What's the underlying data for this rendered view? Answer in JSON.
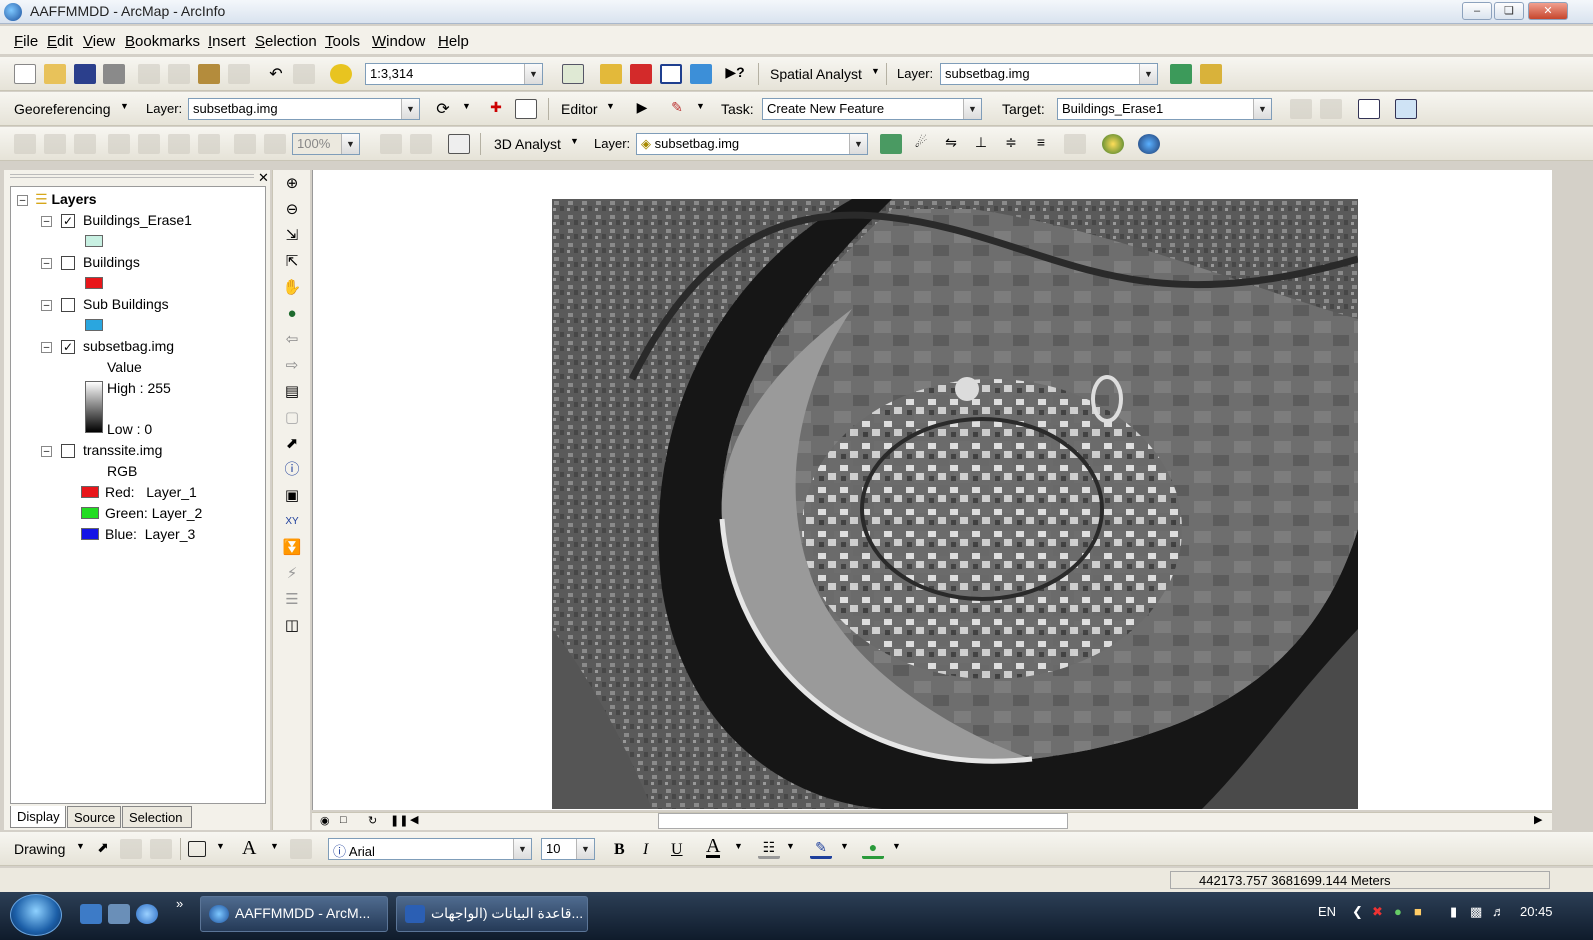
{
  "window": {
    "title": "AAFFMMDD - ArcMap - ArcInfo"
  },
  "menu": [
    "File",
    "Edit",
    "View",
    "Bookmarks",
    "Insert",
    "Selection",
    "Tools",
    "Window",
    "Help"
  ],
  "standard_toolbar": {
    "scale": "1:3,314",
    "spatial_analyst_label": "Spatial Analyst",
    "layer_label": "Layer:",
    "layer_value": "subsetbag.img"
  },
  "georef_toolbar": {
    "georeferencing_label": "Georeferencing",
    "layer_label": "Layer:",
    "layer_value": "subsetbag.img",
    "editor_label": "Editor",
    "task_label": "Task:",
    "task_value": "Create New Feature",
    "target_label": "Target:",
    "target_value": "Buildings_Erase1"
  },
  "third_toolbar": {
    "zoom_value": "100%",
    "analyst_label": "3D Analyst",
    "layer_label": "Layer:",
    "layer_value": "subsetbag.img"
  },
  "toc": {
    "root": "Layers",
    "layers": [
      {
        "name": "Buildings_Erase1",
        "checked": "✓",
        "swatch": "#c8f0e2"
      },
      {
        "name": "Buildings",
        "checked": "",
        "swatch": "#e8161a"
      },
      {
        "name": "Sub Buildings",
        "checked": "",
        "swatch": "#2aa6df"
      },
      {
        "name": "subsetbag.img",
        "checked": "✓",
        "value_label": "Value",
        "high": "High : 255",
        "low": "Low : 0"
      },
      {
        "name": "transsite.img",
        "checked": "",
        "rgb_label": "RGB",
        "bands": [
          {
            "label": "Red:",
            "layer": "Layer_1",
            "color": "#e8161a"
          },
          {
            "label": "Green:",
            "layer": "Layer_2",
            "color": "#22dd22"
          },
          {
            "label": "Blue:",
            "layer": "Layer_3",
            "color": "#1414e6"
          }
        ]
      }
    ],
    "tabs": [
      "Display",
      "Source",
      "Selection"
    ]
  },
  "drawing_toolbar": {
    "drawing_label": "Drawing",
    "font": "Arial",
    "font_size": "10",
    "bold": "B",
    "italic": "I",
    "underline": "U",
    "font_color_glyph": "A",
    "text_tool_glyph": "A"
  },
  "status": {
    "coordinates": "442173.757  3681699.144 Meters"
  },
  "taskbar": {
    "tasks": [
      {
        "label": "AAFFMMDD - ArcM..."
      },
      {
        "label": "قاعدة البيانات (الواجهات..."
      }
    ],
    "lang": "EN",
    "time": "20:45"
  },
  "colors": {
    "titlebar": "#dbe4ef",
    "toolbar": "#f3f1ea",
    "taskbar": "#1b2a3d"
  }
}
